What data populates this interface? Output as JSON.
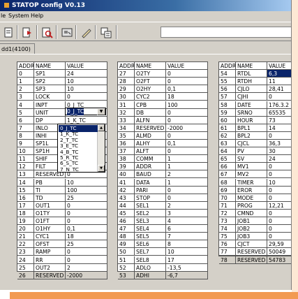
{
  "window": {
    "title": "STATOP config V0.13",
    "title_color": "#0a246a"
  },
  "menu": {
    "file_label": "le",
    "system_label": "System",
    "help_label": "Help"
  },
  "toolbar": {
    "icons": [
      "document-icon",
      "arrow-right-icon",
      "search-icon",
      "image-icon",
      "edit-icon",
      "settings-icon"
    ]
  },
  "tab": {
    "label": "dd1(4100)"
  },
  "columns": {
    "addr": "ADDR",
    "name": "NAME",
    "value": "VALUE"
  },
  "tables": [
    {
      "rows": [
        [
          "0",
          "SP1",
          "24"
        ],
        [
          "1",
          "SP2",
          "10"
        ],
        [
          "2",
          "SP3",
          "10"
        ],
        [
          "3",
          "LOCK",
          "0"
        ],
        [
          "4",
          "INPT",
          "0_J_TC"
        ],
        [
          "5",
          "UNIT",
          "0_J_TC"
        ],
        [
          "6",
          "DP",
          "1_K_TC"
        ],
        [
          "7",
          "INLO",
          "2_T_TC"
        ],
        [
          "8",
          "INHI",
          "3_E_TC"
        ],
        [
          "9",
          "SP1L",
          "4_B_TC"
        ],
        [
          "10",
          "SP1H",
          "5_R_TC"
        ],
        [
          "11",
          "SHIF",
          "6_S_TC"
        ],
        [
          "12",
          "FILT",
          "7_N_TC"
        ],
        [
          "13",
          "RESERVED",
          "0"
        ],
        [
          "14",
          "PB",
          "10"
        ],
        [
          "15",
          "TI",
          "100"
        ],
        [
          "16",
          "TD",
          "25"
        ],
        [
          "17",
          "OUT1",
          "0"
        ],
        [
          "18",
          "O1TY",
          "0"
        ],
        [
          "19",
          "O1FT",
          "0"
        ],
        [
          "20",
          "O1HY",
          "0,1"
        ],
        [
          "21",
          "CYC1",
          "18"
        ],
        [
          "22",
          "OFST",
          "25"
        ],
        [
          "23",
          "RAMP",
          "0"
        ],
        [
          "24",
          "RR",
          "0"
        ],
        [
          "25",
          "OUT2",
          "2"
        ],
        [
          "26",
          "RESERVED",
          "-2000"
        ]
      ]
    },
    {
      "rows": [
        [
          "27",
          "O2TY",
          "0"
        ],
        [
          "28",
          "O2FT",
          "0"
        ],
        [
          "29",
          "O2HY",
          "0,1"
        ],
        [
          "30",
          "CYC2",
          "18"
        ],
        [
          "31",
          "CPB",
          "100"
        ],
        [
          "32",
          "DB",
          "0"
        ],
        [
          "33",
          "ALFN",
          "0"
        ],
        [
          "34",
          "RESERVED",
          "-2000"
        ],
        [
          "35",
          "ALMD",
          "0"
        ],
        [
          "36",
          "ALHY",
          "0,1"
        ],
        [
          "37",
          "ALFT",
          "0"
        ],
        [
          "38",
          "COMM",
          "1"
        ],
        [
          "39",
          "ADDR",
          "1"
        ],
        [
          "40",
          "BAUD",
          "2"
        ],
        [
          "41",
          "DATA",
          "1"
        ],
        [
          "42",
          "PARI",
          "0"
        ],
        [
          "43",
          "STOP",
          "0"
        ],
        [
          "44",
          "SEL1",
          "2"
        ],
        [
          "45",
          "SEL2",
          "3"
        ],
        [
          "46",
          "SEL3",
          "4"
        ],
        [
          "47",
          "SEL4",
          "6"
        ],
        [
          "48",
          "SEL5",
          "7"
        ],
        [
          "49",
          "SEL6",
          "8"
        ],
        [
          "50",
          "SEL7",
          "10"
        ],
        [
          "51",
          "SEL8",
          "17"
        ],
        [
          "52",
          "ADLO",
          "-13,5"
        ],
        [
          "53",
          "ADHI",
          "-6,7"
        ]
      ]
    },
    {
      "rows": [
        [
          "54",
          "RTDL",
          "6,3"
        ],
        [
          "55",
          "RTDH",
          "11"
        ],
        [
          "56",
          "CJLO",
          "28,41"
        ],
        [
          "57",
          "CJHI",
          "0"
        ],
        [
          "58",
          "DATE",
          "176.3.2"
        ],
        [
          "59",
          "SRNO",
          "65535"
        ],
        [
          "60",
          "HOUR",
          "73"
        ],
        [
          "61",
          "BPL1",
          "14"
        ],
        [
          "62",
          "BPL2",
          "0"
        ],
        [
          "63",
          "CJCL",
          "36,3"
        ],
        [
          "64",
          "PV",
          "30"
        ],
        [
          "65",
          "SV",
          "24"
        ],
        [
          "66",
          "MV1",
          "0"
        ],
        [
          "67",
          "MV2",
          "0"
        ],
        [
          "68",
          "TIMER",
          "10"
        ],
        [
          "69",
          "EROR",
          "0"
        ],
        [
          "70",
          "MODE",
          "0"
        ],
        [
          "71",
          "PROG",
          "12,21"
        ],
        [
          "72",
          "CMND",
          "0"
        ],
        [
          "73",
          "JOB1",
          "0"
        ],
        [
          "74",
          "JOB2",
          "0"
        ],
        [
          "75",
          "JOB3",
          "0"
        ],
        [
          "76",
          "CJCT",
          "29,59"
        ],
        [
          "77",
          "RESERVED",
          "50049"
        ],
        [
          "78",
          "RESERVED",
          "54783"
        ]
      ]
    }
  ],
  "dropdown": {
    "selected": "0_J_TC",
    "options": [
      "0_J_TC",
      "1_K_TC",
      "2_T_TC",
      "3_E_TC",
      "4_B_TC",
      "5_R_TC",
      "6_S_TC",
      "7_N_TC"
    ]
  },
  "colors": {
    "selection": "#0a246a",
    "accent_orange": "#f29a52",
    "chrome": "#d4d0c8"
  }
}
